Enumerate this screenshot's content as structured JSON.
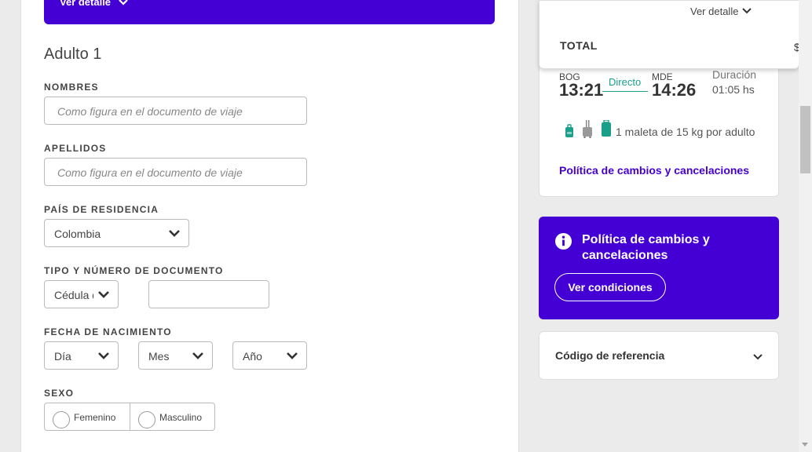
{
  "banner": {
    "ver_detalle": "Ver detalle"
  },
  "form": {
    "adult_title": "Adulto 1",
    "nombres": {
      "label": "NOMBRES",
      "placeholder": "Como figura en el documento de viaje"
    },
    "apellidos": {
      "label": "APELLIDOS",
      "placeholder": "Como figura en el documento de viaje"
    },
    "pais": {
      "label": "PAÍS DE RESIDENCIA",
      "value": "Colombia"
    },
    "documento": {
      "label": "TIPO Y NÚMERO DE DOCUMENTO",
      "type_value": "Cédula de",
      "number_value": ""
    },
    "nacimiento": {
      "label": "FECHA DE NACIMIENTO",
      "dia": "Día",
      "mes": "Mes",
      "anio": "Año"
    },
    "sexo": {
      "label": "SEXO",
      "femenino": "Femenino",
      "masculino": "Masculino"
    }
  },
  "summary_popup": {
    "ver_detalle": "Ver detalle",
    "total_label": "TOTAL",
    "total_value": "$"
  },
  "flight": {
    "origin_code": "BOG",
    "origin_time": "13:21",
    "stops": "Directo",
    "dest_code": "MDE",
    "dest_time": "14:26",
    "duration_label": "Duración",
    "duration_value": "01:05 hs",
    "baggage": "1 maleta de 15 kg por adulto",
    "policy_link": "Política de cambios y cancelaciones"
  },
  "policy_box": {
    "title": "Política de cambios y cancelaciones",
    "button": "Ver condiciones"
  },
  "reference": {
    "label": "Código de referencia"
  },
  "colors": {
    "brand": "#4400d4",
    "accent_teal": "#1a9f8a"
  },
  "icons": [
    "chevron-down-icon",
    "info-icon",
    "backpack-icon",
    "carry-on-icon",
    "suitcase-icon",
    "radio-icon"
  ]
}
